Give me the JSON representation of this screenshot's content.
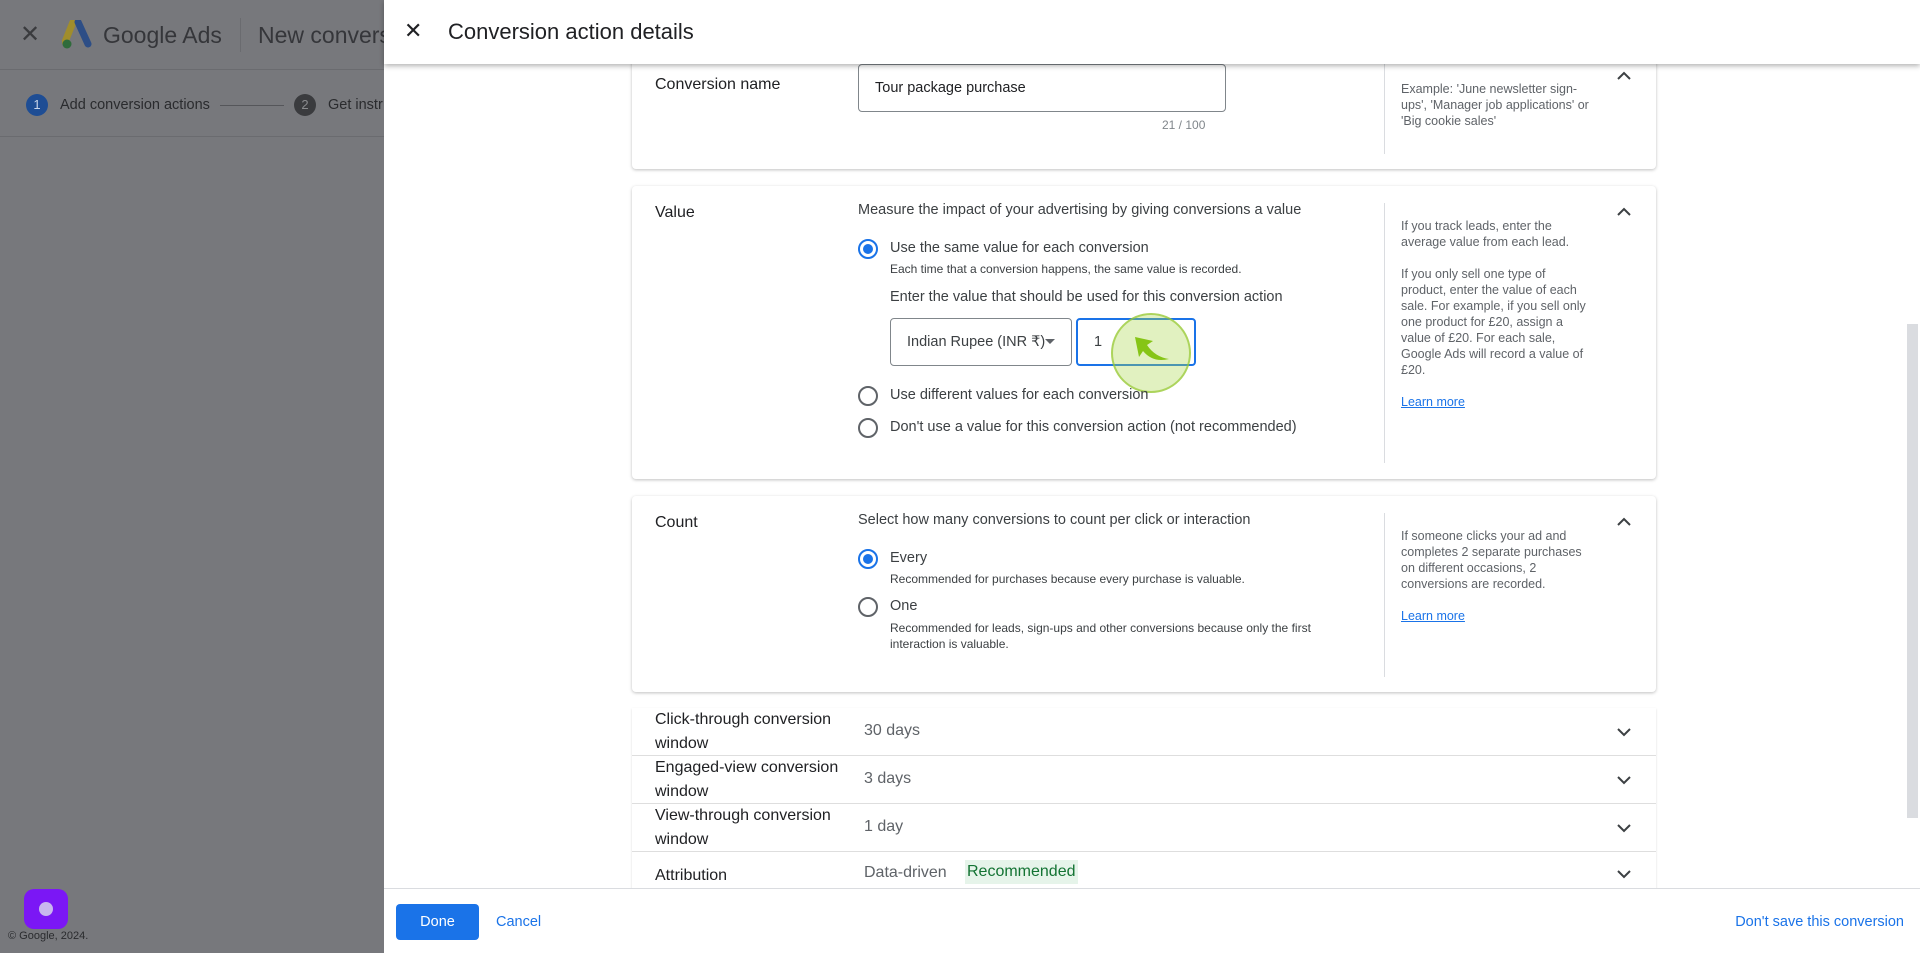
{
  "background": {
    "app_name": "Google Ads",
    "page_title": "New convers",
    "steps": [
      {
        "num": "1",
        "label": "Add conversion actions"
      },
      {
        "num": "2",
        "label": "Get instr"
      }
    ],
    "copyright": "© Google, 2024."
  },
  "panel": {
    "title": "Conversion action details"
  },
  "conversion_name": {
    "label": "Conversion name",
    "value": "Tour package purchase",
    "counter": "21 / 100",
    "help": "Example: 'June newsletter sign-ups', 'Manager job applications' or 'Big cookie sales'"
  },
  "value": {
    "label": "Value",
    "description": "Measure the impact of your advertising by giving conversions a value",
    "options": [
      {
        "label": "Use the same value for each conversion",
        "sub": "Each time that a conversion happens, the same value is recorded.",
        "selected": true
      },
      {
        "label": "Use different values for each conversion",
        "selected": false
      },
      {
        "label": "Don't use a value for this conversion action (not recommended)",
        "selected": false
      }
    ],
    "enter_prompt": "Enter the value that should be used for this conversion action",
    "currency": "Indian Rupee (INR ₹)",
    "amount": "1",
    "help1": "If you track leads, enter the average value from each lead.",
    "help2": "If you only sell one type of product, enter the value of each sale. For example, if you sell only one product for £20, assign a value of £20. For each sale, Google Ads will record a value of £20.",
    "learn_more": "Learn more"
  },
  "count": {
    "label": "Count",
    "description": "Select how many conversions to count per click or interaction",
    "options": [
      {
        "label": "Every",
        "sub": "Recommended for purchases because every purchase is valuable.",
        "selected": true
      },
      {
        "label": "One",
        "sub": "Recommended for leads, sign-ups and other conversions because only the first interaction is valuable.",
        "selected": false
      }
    ],
    "help": "If someone clicks your ad and completes 2 separate purchases on different occasions, 2 conversions are recorded.",
    "learn_more": "Learn more"
  },
  "rows": [
    {
      "label": "Click-through conversion window",
      "value": "30 days"
    },
    {
      "label": "Engaged-view conversion window",
      "value": "3 days"
    },
    {
      "label": "View-through conversion window",
      "value": "1 day"
    },
    {
      "label": "Attribution",
      "value": "Data-driven",
      "badge": "Recommended"
    }
  ],
  "footer": {
    "done": "Done",
    "cancel": "Cancel",
    "dont_save": "Don't save this conversion"
  },
  "colors": {
    "primary": "#1a73e8",
    "badge_bg": "#e6f4ea",
    "badge_text": "#137333",
    "cursor_highlight": "#a8d84a"
  }
}
